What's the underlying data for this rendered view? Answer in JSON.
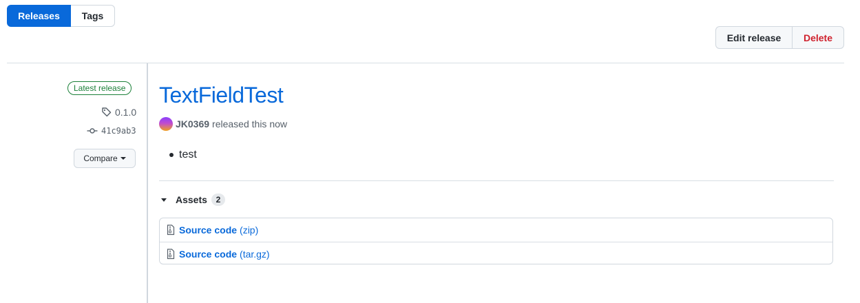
{
  "subnav": {
    "releases": "Releases",
    "tags": "Tags"
  },
  "actions": {
    "edit": "Edit release",
    "delete": "Delete"
  },
  "sidebar": {
    "latest_badge": "Latest release",
    "tag": "0.1.0",
    "commit": "41c9ab3",
    "compare": "Compare"
  },
  "release": {
    "title": "TextFieldTest",
    "author": "JK0369",
    "released_text": "released this now",
    "body_items": [
      "test"
    ]
  },
  "assets": {
    "label": "Assets",
    "count": "2",
    "items": [
      {
        "name": "Source code",
        "ext": "(zip)"
      },
      {
        "name": "Source code",
        "ext": "(tar.gz)"
      }
    ]
  },
  "colors": {
    "accent": "#0969da",
    "danger": "#cf222e",
    "success": "#1a7f37"
  },
  "icons": [
    "tag-icon",
    "git-commit-icon",
    "triangle-down-icon",
    "file-zip-icon"
  ]
}
